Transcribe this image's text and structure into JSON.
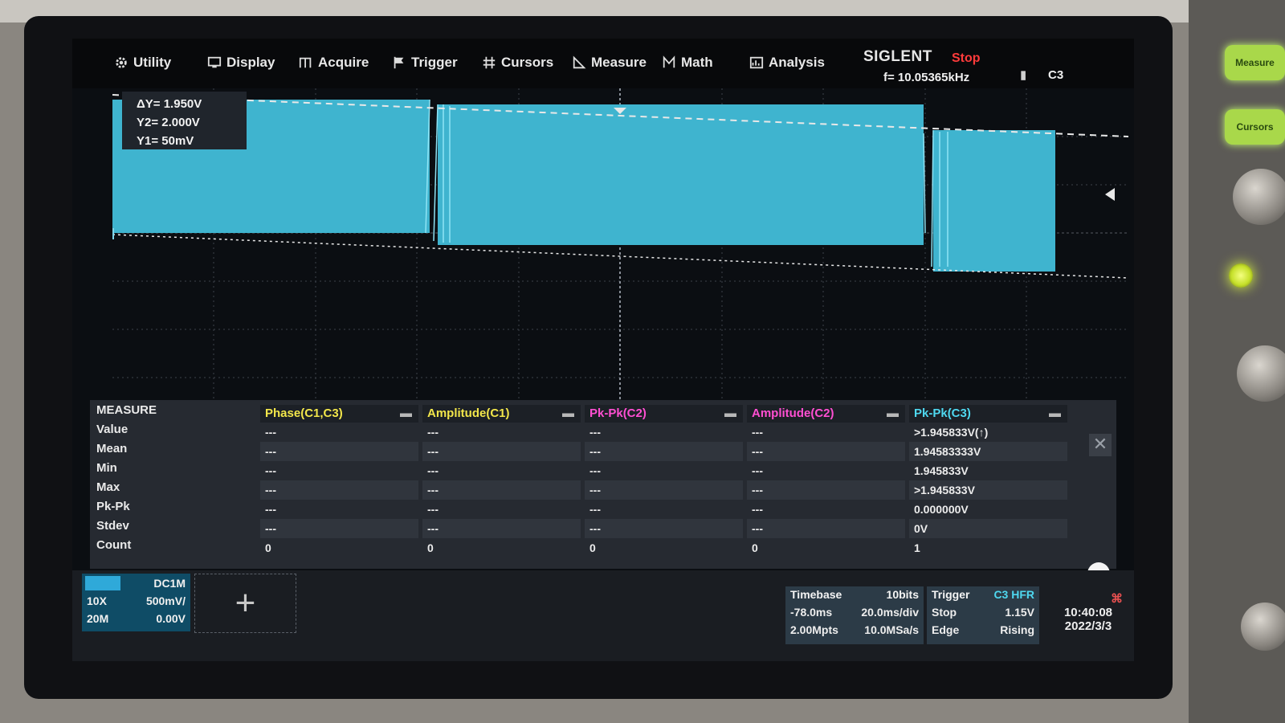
{
  "menu": [
    {
      "label": "Utility",
      "icon": "gear-icon"
    },
    {
      "label": "Display",
      "icon": "display-icon"
    },
    {
      "label": "Acquire",
      "icon": "acquire-icon"
    },
    {
      "label": "Trigger",
      "icon": "flag-icon"
    },
    {
      "label": "Cursors",
      "icon": "cursors-icon"
    },
    {
      "label": "Measure",
      "icon": "measure-icon"
    },
    {
      "label": "Math",
      "icon": "math-icon"
    },
    {
      "label": "Analysis",
      "icon": "analysis-icon"
    }
  ],
  "header": {
    "brand": "SIGLENT",
    "run_state": "Stop",
    "frequency": "f= 10.05365kHz",
    "channel": "C3"
  },
  "cursor_readout": {
    "dy": "ΔY= 1.950V",
    "y2": "Y2= 2.000V",
    "y1": "Y1= 50mV"
  },
  "measure": {
    "title": "MEASURE",
    "row_labels": [
      "Value",
      "Mean",
      "Min",
      "Max",
      "Pk-Pk",
      "Stdev",
      "Count"
    ],
    "columns": [
      {
        "name": "Phase(C1,C3)",
        "color": "#f2e64a",
        "values": [
          "---",
          "---",
          "---",
          "---",
          "---",
          "---",
          "0"
        ]
      },
      {
        "name": "Amplitude(C1)",
        "color": "#f2e64a",
        "values": [
          "---",
          "---",
          "---",
          "---",
          "---",
          "---",
          "0"
        ]
      },
      {
        "name": "Pk-Pk(C2)",
        "color": "#ff4fd2",
        "values": [
          "---",
          "---",
          "---",
          "---",
          "---",
          "---",
          "0"
        ]
      },
      {
        "name": "Amplitude(C2)",
        "color": "#ff4fd2",
        "values": [
          "---",
          "---",
          "---",
          "---",
          "---",
          "---",
          "0"
        ]
      },
      {
        "name": "Pk-Pk(C3)",
        "color": "#4fd8f0",
        "values": [
          ">1.945833V(↑)",
          "1.94583333V",
          "1.945833V",
          ">1.945833V",
          "0.000000V",
          "0V",
          "1"
        ]
      }
    ]
  },
  "channel_box": {
    "coupling": "DC1M",
    "probe": "10X",
    "scale": "500mV/",
    "bw": "20M",
    "offset": "0.00V"
  },
  "timebase": {
    "title": "Timebase",
    "bits": "10bits",
    "delay": "-78.0ms",
    "scale": "20.0ms/div",
    "points": "2.00Mpts",
    "rate": "10.0MSa/s"
  },
  "trigger": {
    "title": "Trigger",
    "source": "C3 HFR",
    "state": "Stop",
    "level": "1.15V",
    "type": "Edge",
    "slope": "Rising"
  },
  "clock": {
    "time": "10:40:08",
    "date": "2022/3/3"
  },
  "softkeys": [
    "Measure",
    "Cursors"
  ],
  "colors": {
    "trace": "#3fb4cf",
    "accent": "#a9d84a",
    "stop": "#ff3b3b"
  }
}
